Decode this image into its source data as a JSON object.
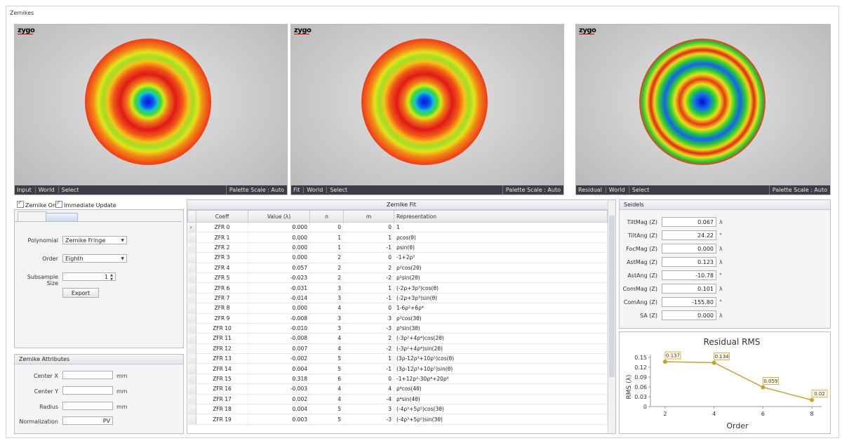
{
  "window": {
    "title": "Zernikes"
  },
  "viewers": [
    {
      "logo": "zygo",
      "mode": "Input",
      "world": "World",
      "select": "Select",
      "palette": "Palette Scale : Auto"
    },
    {
      "logo": "zygo",
      "mode": "Fit",
      "world": "World",
      "select": "Select",
      "palette": "Palette Scale : Auto"
    },
    {
      "logo": "zygo",
      "mode": "Residual",
      "world": "World",
      "select": "Select",
      "palette": "Palette Scale : Auto"
    }
  ],
  "controls": {
    "zernike_on": "Zernike On",
    "immediate_update": "Immediate Update",
    "polynomial_label": "Polynomial",
    "polynomial_value": "Zernike Fringe",
    "order_label": "Order",
    "order_value": "Eighth",
    "subsample_label": "Subsample Size",
    "subsample_value": "1",
    "export_label": "Export"
  },
  "attributes": {
    "title": "Zernike Attributes",
    "center_x": "Center X",
    "center_y": "Center Y",
    "radius": "Radius",
    "normalization": "Normalization",
    "normalization_value": "PV",
    "unit": "mm"
  },
  "fit_table": {
    "title": "Zernike Fit",
    "headers": [
      "Coeff",
      "Value (λ)",
      "n",
      "m",
      "Representation"
    ],
    "rows": [
      [
        "ZFR 0",
        "0.000",
        "0",
        "0",
        "1"
      ],
      [
        "ZFR 1",
        "0.000",
        "1",
        "1",
        "ρcos(θ)"
      ],
      [
        "ZFR 2",
        "0.000",
        "1",
        "-1",
        "ρsin(θ)"
      ],
      [
        "ZFR 3",
        "0.000",
        "2",
        "0",
        "-1+2ρ²"
      ],
      [
        "ZFR 4",
        "0.057",
        "2",
        "2",
        "ρ²cos(2θ)"
      ],
      [
        "ZFR 5",
        "-0.023",
        "2",
        "-2",
        "ρ²sin(2θ)"
      ],
      [
        "ZFR 6",
        "-0.031",
        "3",
        "1",
        "(-2ρ+3ρ³)cos(θ)"
      ],
      [
        "ZFR 7",
        "-0.014",
        "3",
        "-1",
        "(-2ρ+3ρ³)sin(θ)"
      ],
      [
        "ZFR 8",
        "0.000",
        "4",
        "0",
        "1-6ρ²+6ρ⁴"
      ],
      [
        "ZFR 9",
        "-0.008",
        "3",
        "3",
        "ρ³cos(3θ)"
      ],
      [
        "ZFR 10",
        "-0.010",
        "3",
        "-3",
        "ρ³sin(3θ)"
      ],
      [
        "ZFR 11",
        "-0.008",
        "4",
        "2",
        "(-3ρ²+4ρ⁴)cos(2θ)"
      ],
      [
        "ZFR 12",
        "0.007",
        "4",
        "-2",
        "(-3ρ²+4ρ⁴)sin(2θ)"
      ],
      [
        "ZFR 13",
        "-0.002",
        "5",
        "1",
        "(3ρ-12ρ³+10ρ⁵)cos(θ)"
      ],
      [
        "ZFR 14",
        "0.004",
        "5",
        "-1",
        "(3ρ-12ρ³+10ρ⁵)sin(θ)"
      ],
      [
        "ZFR 15",
        "0.318",
        "6",
        "0",
        "-1+12ρ²-30ρ⁴+20ρ⁶"
      ],
      [
        "ZFR 16",
        "-0.003",
        "4",
        "4",
        "ρ⁴cos(4θ)"
      ],
      [
        "ZFR 17",
        "0.002",
        "4",
        "-4",
        "ρ⁴sin(4θ)"
      ],
      [
        "ZFR 18",
        "0.004",
        "5",
        "3",
        "(-4ρ³+5ρ⁵)cos(3θ)"
      ],
      [
        "ZFR 19",
        "0.003",
        "5",
        "-3",
        "(-4ρ³+5ρ⁵)sin(3θ)"
      ]
    ]
  },
  "seidels": {
    "title": "Seidels",
    "rows": [
      {
        "label": "TiltMag (Z)",
        "value": "0.067",
        "unit": "λ"
      },
      {
        "label": "TiltAng (Z)",
        "value": "24.22",
        "unit": "°"
      },
      {
        "label": "FocMag (Z)",
        "value": "0.000",
        "unit": "λ"
      },
      {
        "label": "AstMag (Z)",
        "value": "0.123",
        "unit": "λ"
      },
      {
        "label": "AstAng (Z)",
        "value": "-10.78",
        "unit": "°"
      },
      {
        "label": "ComMag (Z)",
        "value": "0.101",
        "unit": "λ"
      },
      {
        "label": "ComAng (Z)",
        "value": "-155.80",
        "unit": "°"
      },
      {
        "label": "SA (Z)",
        "value": "0.000",
        "unit": "λ"
      }
    ]
  },
  "chart_data": {
    "type": "line",
    "title": "Residual RMS",
    "xlabel": "Order",
    "ylabel": "RMS (λ)",
    "x": [
      2,
      4,
      6,
      8
    ],
    "values": [
      0.137,
      0.134,
      0.059,
      0.02
    ],
    "labels": [
      "0.137",
      "0.134",
      "0.059",
      "0.02"
    ],
    "xticks": [
      "2",
      "4",
      "6",
      "8"
    ],
    "yticks": [
      "0",
      "0.03",
      "0.06",
      "0.09",
      "0.12",
      "0.15"
    ],
    "ylim": [
      0,
      0.15
    ],
    "xlim": [
      1.4,
      8.4
    ],
    "color": "#c9a227",
    "grid": false
  }
}
